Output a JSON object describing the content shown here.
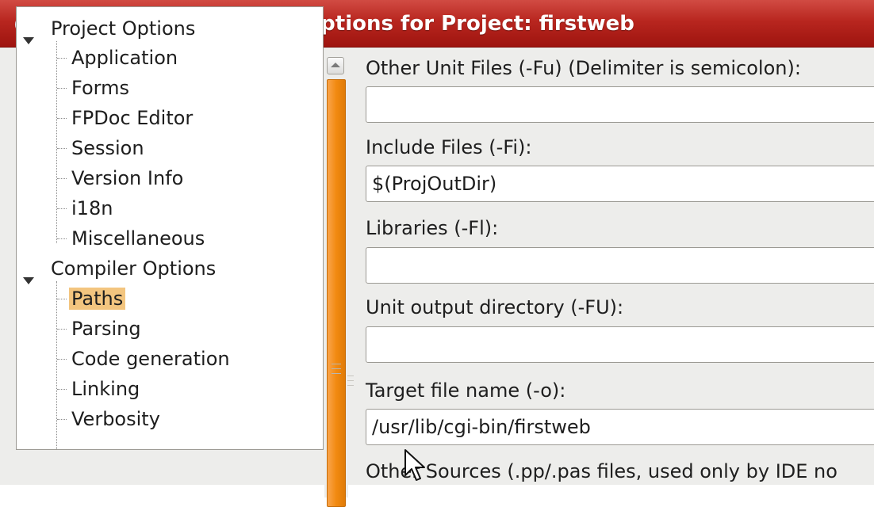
{
  "window": {
    "title": "Options for Project: firstweb",
    "icon": "lazarus-app-icon"
  },
  "tree": {
    "groups": [
      {
        "label": "Project Options",
        "expanded": true,
        "items": [
          "Application",
          "Forms",
          "FPDoc Editor",
          "Session",
          "Version Info",
          "i18n",
          "Miscellaneous"
        ]
      },
      {
        "label": "Compiler Options",
        "expanded": true,
        "items": [
          "Paths",
          "Parsing",
          "Code generation",
          "Linking",
          "Verbosity"
        ]
      }
    ],
    "selected": "Paths"
  },
  "paths": {
    "other_unit_files": {
      "label": "Other Unit Files (-Fu) (Delimiter is semicolon):",
      "value": ""
    },
    "include_files": {
      "label": "Include Files (-Fi):",
      "value": "$(ProjOutDir)"
    },
    "libraries": {
      "label": "Libraries (-Fl):",
      "value": ""
    },
    "unit_output_directory": {
      "label": "Unit output directory (-FU):",
      "value": ""
    },
    "target_file_name": {
      "label": "Target file name (-o):",
      "value": "/usr/lib/cgi-bin/firstweb"
    },
    "other_sources": {
      "label": "Other Sources (.pp/.pas files, used only by IDE no"
    }
  },
  "colors": {
    "titlebar": "#b8261f",
    "selection": "#f3c57f",
    "scroll_thumb": "#f28a10"
  }
}
